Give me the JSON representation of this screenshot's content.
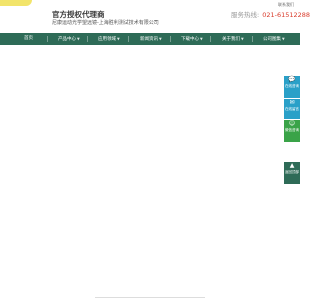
{
  "topbar": {
    "link": "联系我们"
  },
  "brand": {
    "title": "官方授权代理商",
    "subtitle": "尼康运动光学望远镜-上海胜利测试技术有限公司"
  },
  "hotline": {
    "label": "服务热线:",
    "number": "021-61512288"
  },
  "nav": {
    "items": [
      {
        "label": "首页",
        "dropdown": false
      },
      {
        "label": "产品中心",
        "dropdown": true
      },
      {
        "label": "应用领域",
        "dropdown": true
      },
      {
        "label": "新闻资讯",
        "dropdown": true
      },
      {
        "label": "下载中心",
        "dropdown": true
      },
      {
        "label": "关于我们",
        "dropdown": true
      },
      {
        "label": "公司图集",
        "dropdown": true
      }
    ]
  },
  "floating": [
    {
      "label": "在线咨询",
      "icon": "chat-icon",
      "color": "#2aa0c8"
    },
    {
      "label": "在线留言",
      "icon": "message-icon",
      "color": "#2aa0c8"
    },
    {
      "label": "微信咨询",
      "icon": "wechat-icon",
      "color": "#3aa348"
    },
    {
      "label": "返回顶部",
      "icon": "up-arrow-icon",
      "color": "#2e6b57"
    }
  ],
  "colors": {
    "nav_bg": "#2e6b57",
    "accent_red": "#d93b2b",
    "logo": "#f2e46a"
  }
}
